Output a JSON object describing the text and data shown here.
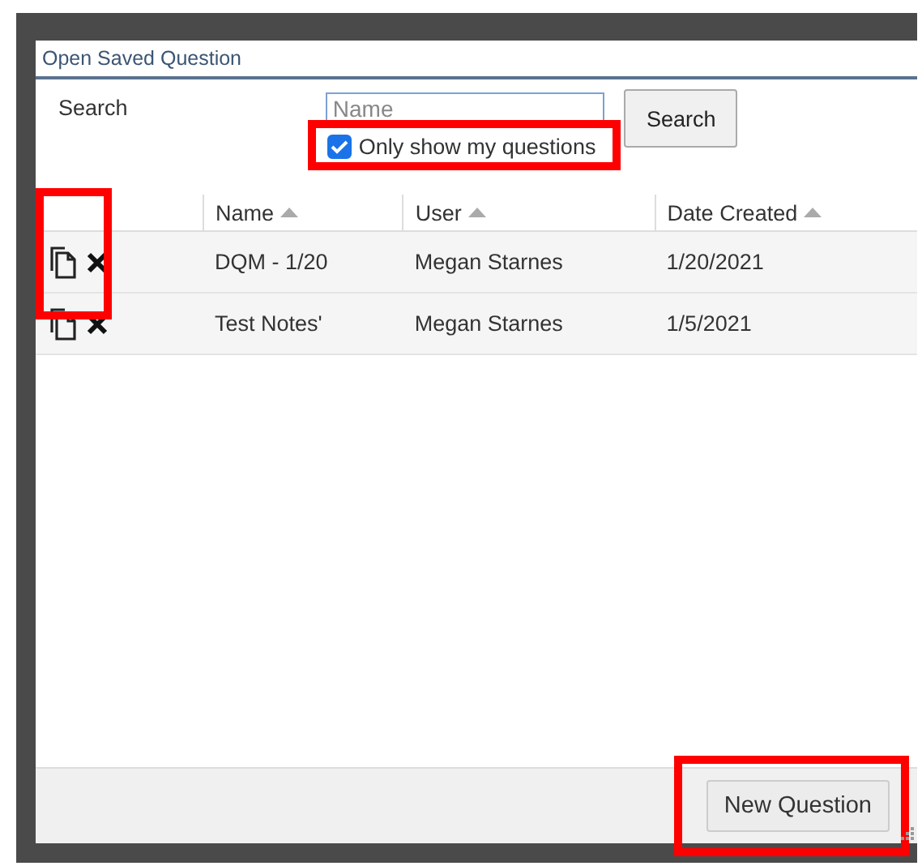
{
  "window": {
    "title": "Open Saved Question"
  },
  "search": {
    "label": "Search",
    "placeholder": "Name",
    "button": "Search"
  },
  "filter": {
    "label": "Only show my questions",
    "checked": true,
    "highlighted": true
  },
  "table": {
    "columns": [
      {
        "label": "Name",
        "sorted": true
      },
      {
        "label": "User",
        "sorted": true
      },
      {
        "label": "Date Created",
        "sorted": true
      }
    ],
    "actions_highlighted": true,
    "rows": [
      {
        "cells": [
          "DQM - 1/20",
          "Megan Starnes",
          "1/20/2021"
        ]
      },
      {
        "cells": [
          "Test Notes'",
          "Megan Starnes",
          "1/5/2021"
        ]
      }
    ]
  },
  "footer": {
    "button": "New Question",
    "highlighted": true
  }
}
